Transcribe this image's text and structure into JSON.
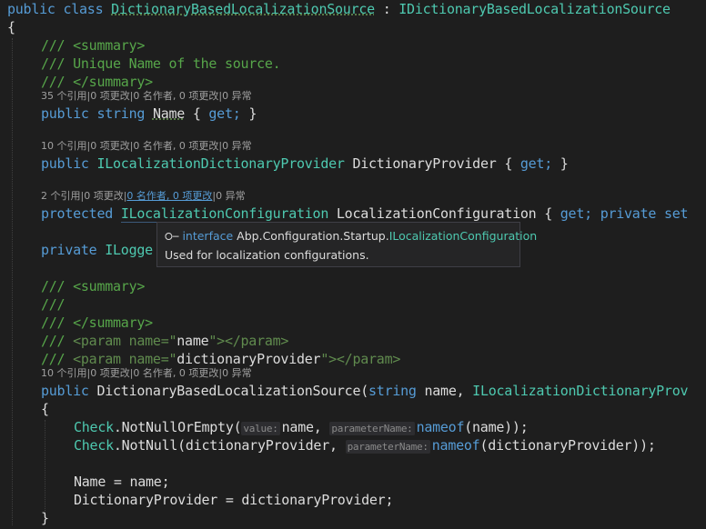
{
  "editor": {
    "line_class": [
      "public",
      "class",
      "DictionaryBasedLocalizationSource",
      ":",
      "IDictionaryBasedLocalizationSource"
    ],
    "open_brace": "{",
    "close_brace": "}",
    "summary_open": "/// <summary>",
    "summary_text": "/// Unique Name of the source.",
    "summary_close": "/// </summary>",
    "name_lens": "35 个引用|0 项更改|0 名作者, 0 项更改|0 异常",
    "name_prop": [
      "public",
      "string",
      "Name",
      "{",
      "get;",
      "}"
    ],
    "provider_lens": "10 个引用|0 项更改|0 名作者, 0 项更改|0 异常",
    "provider_prop": [
      "public",
      "ILocalizationDictionaryProvider",
      "DictionaryProvider",
      "{",
      "get;",
      "}"
    ],
    "config_lens_a": "2 个引用|0 项更改|",
    "config_lens_link": "0 名作者, 0 项更改",
    "config_lens_b": "|0 异常",
    "config_prop": [
      "protected",
      "ILocalizationConfiguration",
      "LocalizationConfiguration",
      "{",
      "get;",
      "private",
      "set"
    ],
    "logger_line": [
      "private",
      "ILogge"
    ],
    "ctor_summary_open": "/// <summary>",
    "ctor_summary_empty": "///",
    "ctor_summary_close": "/// </summary>",
    "param_name": [
      "///",
      "<param name=\"",
      "name",
      "\"></param>"
    ],
    "param_provider": [
      "///",
      "<param name=\"",
      "dictionaryProvider",
      "\"></param>"
    ],
    "ctor_lens": "10 个引用|0 项更改|0 名作者, 0 项更改|0 异常",
    "ctor_line": [
      "public",
      "DictionaryBasedLocalizationSource",
      "(",
      "string",
      "name,",
      "ILocalizationDictionaryProv"
    ],
    "ctor_open": "{",
    "check1": [
      "Check",
      ".NotNullOrEmpty(",
      "value:",
      "name,",
      "parameterName:",
      "nameof",
      "(name));"
    ],
    "check2": [
      "Check",
      ".NotNull(dictionaryProvider,",
      "parameterName:",
      "nameof",
      "(dictionaryProvider));"
    ],
    "assign1": "Name = name;",
    "assign2": "DictionaryProvider = dictionaryProvider;",
    "ctor_close": "}"
  },
  "tooltip": {
    "icon": "interface-icon",
    "kind": "interface",
    "namespace": "Abp.Configuration.Startup.",
    "type_name": "ILocalizationConfiguration",
    "description": "Used for localization configurations."
  },
  "colors": {
    "background": "#1e1e1e",
    "keyword": "#569cd6",
    "type": "#4ec9b0",
    "comment": "#57a64a",
    "text": "#dcdcdc"
  }
}
